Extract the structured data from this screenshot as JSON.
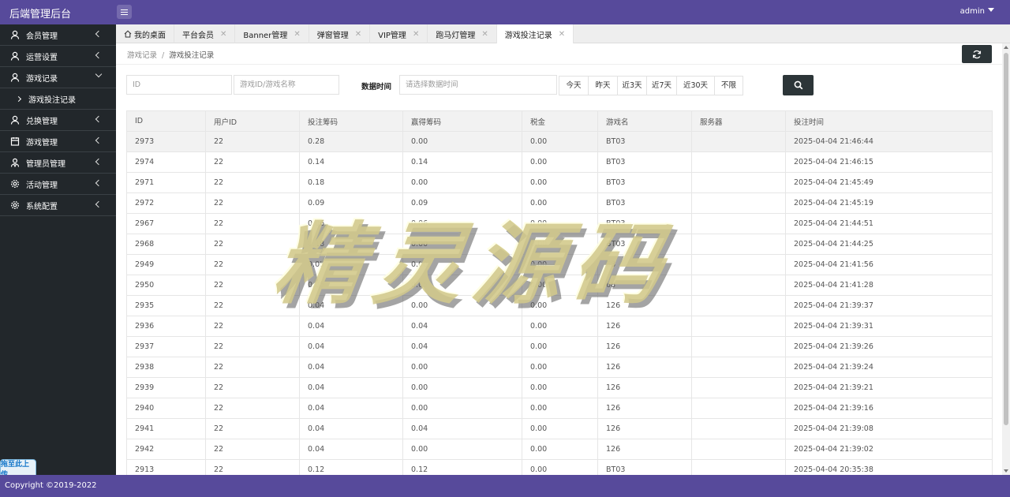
{
  "app": {
    "title": "后端管理后台",
    "user": "admin"
  },
  "sidebar": {
    "items": [
      {
        "label": "会员管理",
        "icon": "user-icon",
        "expanded": false
      },
      {
        "label": "运营设置",
        "icon": "user-icon",
        "expanded": false
      },
      {
        "label": "游戏记录",
        "icon": "user-icon",
        "expanded": true
      },
      {
        "label": "兑换管理",
        "icon": "user-icon",
        "expanded": false
      },
      {
        "label": "游戏管理",
        "icon": "calendar-icon",
        "expanded": false
      },
      {
        "label": "管理员管理",
        "icon": "users-icon",
        "expanded": false
      },
      {
        "label": "活动管理",
        "icon": "gear-icon",
        "expanded": false
      },
      {
        "label": "系统配置",
        "icon": "gear-icon",
        "expanded": false
      }
    ],
    "sub_item": "游戏投注记录",
    "upload_badge": "拖至此上传"
  },
  "tabs": [
    {
      "label": "我的桌面",
      "closable": false
    },
    {
      "label": "平台会员",
      "closable": true
    },
    {
      "label": "Banner管理",
      "closable": true
    },
    {
      "label": "弹窗管理",
      "closable": true
    },
    {
      "label": "VIP管理",
      "closable": true
    },
    {
      "label": "跑马灯管理",
      "closable": true
    },
    {
      "label": "游戏投注记录",
      "closable": true,
      "active": true
    }
  ],
  "breadcrumb": {
    "parent": "游戏记录",
    "separator": "/",
    "current": "游戏投注记录"
  },
  "filters": {
    "id_placeholder": "ID",
    "game_placeholder": "游戏ID/游戏名称",
    "time_label": "数据时间",
    "time_placeholder": "请选择数据时间",
    "quick_ranges": [
      "今天",
      "昨天",
      "近3天",
      "近7天",
      "近30天",
      "不限"
    ]
  },
  "table": {
    "columns": [
      "ID",
      "用户ID",
      "投注筹码",
      "赢得筹码",
      "税金",
      "游戏名",
      "服务器",
      "投注时间"
    ],
    "rows": [
      [
        "2973",
        "22",
        "0.28",
        "0.00",
        "0.00",
        "BT03",
        "",
        "2025-04-04 21:46:44"
      ],
      [
        "2974",
        "22",
        "0.14",
        "0.14",
        "0.00",
        "BT03",
        "",
        "2025-04-04 21:46:15"
      ],
      [
        "2971",
        "22",
        "0.18",
        "0.00",
        "0.00",
        "BT03",
        "",
        "2025-04-04 21:45:49"
      ],
      [
        "2972",
        "22",
        "0.09",
        "0.09",
        "0.00",
        "BT03",
        "",
        "2025-04-04 21:45:19"
      ],
      [
        "2967",
        "22",
        "0.06",
        "0.06",
        "0.00",
        "BT03",
        "",
        "2025-04-04 21:44:51"
      ],
      [
        "2968",
        "22",
        "0.18",
        "0.00",
        "0.00",
        "BT03",
        "",
        "2025-04-04 21:44:25"
      ],
      [
        "2949",
        "22",
        "0.05",
        "0.00",
        "0.00",
        "68",
        "",
        "2025-04-04 21:41:56"
      ],
      [
        "2950",
        "22",
        "0.05",
        "0.05",
        "0.00",
        "68",
        "",
        "2025-04-04 21:41:28"
      ],
      [
        "2935",
        "22",
        "0.04",
        "0.00",
        "0.00",
        "126",
        "",
        "2025-04-04 21:39:37"
      ],
      [
        "2936",
        "22",
        "0.04",
        "0.04",
        "0.00",
        "126",
        "",
        "2025-04-04 21:39:31"
      ],
      [
        "2937",
        "22",
        "0.04",
        "0.04",
        "0.00",
        "126",
        "",
        "2025-04-04 21:39:26"
      ],
      [
        "2938",
        "22",
        "0.04",
        "0.00",
        "0.00",
        "126",
        "",
        "2025-04-04 21:39:24"
      ],
      [
        "2939",
        "22",
        "0.04",
        "0.00",
        "0.00",
        "126",
        "",
        "2025-04-04 21:39:21"
      ],
      [
        "2940",
        "22",
        "0.04",
        "0.00",
        "0.00",
        "126",
        "",
        "2025-04-04 21:39:16"
      ],
      [
        "2941",
        "22",
        "0.04",
        "0.04",
        "0.00",
        "126",
        "",
        "2025-04-04 21:39:08"
      ],
      [
        "2942",
        "22",
        "0.04",
        "0.00",
        "0.00",
        "126",
        "",
        "2025-04-04 21:39:02"
      ],
      [
        "2913",
        "22",
        "0.12",
        "0.12",
        "0.00",
        "BT03",
        "",
        "2025-04-04 20:35:38"
      ]
    ]
  },
  "watermark": "精灵源码",
  "footer": {
    "copyright": "Copyright ©2019-2022"
  },
  "colors": {
    "topbar": "#574a9b",
    "sidebar": "#22272b",
    "button_dark": "#2c3538"
  }
}
